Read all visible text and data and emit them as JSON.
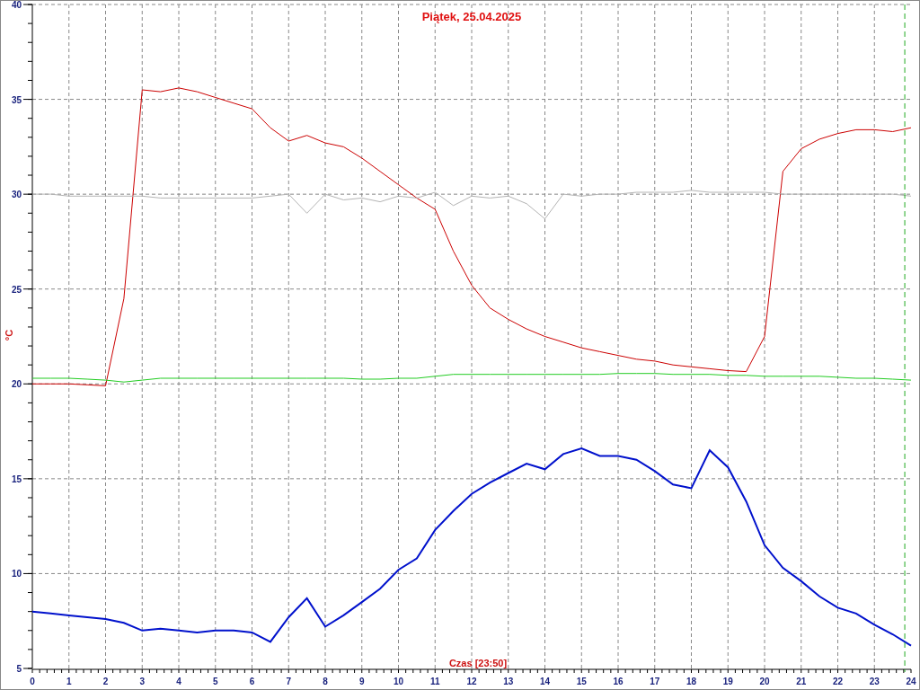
{
  "chart_data": {
    "type": "line",
    "title": "Piątek, 25.04.2025",
    "xlabel": "Czas [23:50]",
    "ylabel": "°C",
    "x": [
      0,
      0.5,
      1,
      1.5,
      2,
      2.5,
      3,
      3.5,
      4,
      4.5,
      5,
      5.5,
      6,
      6.5,
      7,
      7.5,
      8,
      8.5,
      9,
      9.5,
      10,
      10.5,
      11,
      11.5,
      12,
      12.5,
      13,
      13.5,
      14,
      14.5,
      15,
      15.5,
      16,
      16.5,
      17,
      17.5,
      18,
      18.5,
      19,
      19.5,
      20,
      20.5,
      21,
      21.5,
      22,
      22.5,
      23,
      23.5,
      24
    ],
    "series": [
      {
        "color": "#cc0000",
        "values": [
          20.0,
          20.0,
          20.0,
          19.95,
          19.9,
          24.5,
          35.5,
          35.4,
          35.6,
          35.4,
          35.1,
          34.8,
          34.5,
          33.5,
          32.8,
          33.1,
          32.7,
          32.5,
          31.9,
          31.2,
          30.5,
          29.8,
          29.2,
          27.0,
          25.2,
          24.0,
          23.4,
          22.9,
          22.5,
          22.2,
          21.9,
          21.7,
          21.5,
          21.3,
          21.2,
          21.0,
          20.9,
          20.8,
          20.7,
          20.65,
          22.5,
          31.2,
          32.4,
          32.9,
          33.2,
          33.4,
          33.4,
          33.3,
          33.5
        ]
      },
      {
        "color": "#b4b4b4",
        "values": [
          30.0,
          30.0,
          29.9,
          29.9,
          29.9,
          29.9,
          29.9,
          29.8,
          29.8,
          29.8,
          29.8,
          29.8,
          29.8,
          29.9,
          30.0,
          29.0,
          30.0,
          29.7,
          29.8,
          29.6,
          29.9,
          29.8,
          30.1,
          29.4,
          29.9,
          29.8,
          29.9,
          29.5,
          28.7,
          30.0,
          29.9,
          30.0,
          30.0,
          30.1,
          30.1,
          30.1,
          30.2,
          30.1,
          30.1,
          30.1,
          30.1,
          30.0,
          30.0,
          30.0,
          30.0,
          30.0,
          30.0,
          30.0,
          29.9
        ]
      },
      {
        "color": "#22cc22",
        "values": [
          20.3,
          20.3,
          20.3,
          20.25,
          20.2,
          20.1,
          20.2,
          20.3,
          20.3,
          20.3,
          20.3,
          20.3,
          20.3,
          20.3,
          20.3,
          20.3,
          20.3,
          20.3,
          20.25,
          20.25,
          20.3,
          20.3,
          20.4,
          20.5,
          20.5,
          20.5,
          20.5,
          20.5,
          20.5,
          20.5,
          20.5,
          20.5,
          20.55,
          20.55,
          20.55,
          20.5,
          20.5,
          20.5,
          20.45,
          20.45,
          20.4,
          20.4,
          20.4,
          20.4,
          20.35,
          20.3,
          20.3,
          20.25,
          20.2
        ]
      },
      {
        "color": "#0011cc",
        "values": [
          8.0,
          7.9,
          7.8,
          7.7,
          7.6,
          7.4,
          7.0,
          7.1,
          7.0,
          6.9,
          7.0,
          7.0,
          6.9,
          6.4,
          7.7,
          8.7,
          7.2,
          7.8,
          8.5,
          9.2,
          10.2,
          10.8,
          12.3,
          13.3,
          14.2,
          14.8,
          15.3,
          15.8,
          15.5,
          16.3,
          16.6,
          16.2,
          16.2,
          16.0,
          15.4,
          14.7,
          14.5,
          16.5,
          15.6,
          13.8,
          11.5,
          10.3,
          9.6,
          8.8,
          8.2,
          7.9,
          7.3,
          6.8,
          6.2
        ]
      }
    ],
    "xlim": [
      0,
      24
    ],
    "ylim": [
      5,
      40
    ],
    "xticks": [
      0,
      1,
      2,
      3,
      4,
      5,
      6,
      7,
      8,
      9,
      10,
      11,
      12,
      13,
      14,
      15,
      16,
      17,
      18,
      19,
      20,
      21,
      22,
      23,
      24
    ],
    "yticks": [
      5,
      10,
      15,
      20,
      25,
      30,
      35,
      40
    ],
    "grid": true,
    "ref_lines": [
      {
        "axis": "x",
        "value": 23.83,
        "color": "#22aa22"
      }
    ]
  }
}
